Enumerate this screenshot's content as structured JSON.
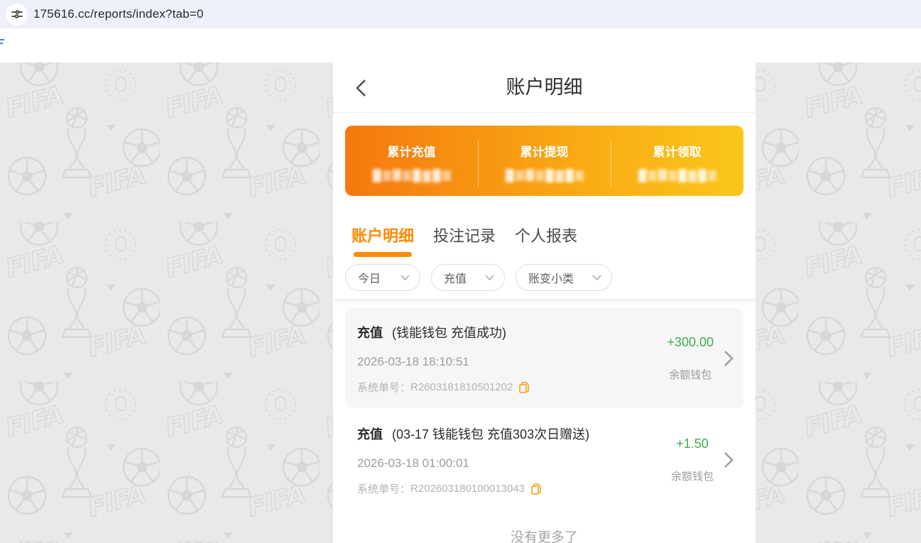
{
  "browser": {
    "url": "175616.cc/reports/index?tab=0",
    "site_info_icon": "tune-icon"
  },
  "header": {
    "title": "账户明细",
    "back_icon": "chevron-left"
  },
  "summary": {
    "cards": [
      {
        "label": "累计充值",
        "value_redacted": true
      },
      {
        "label": "累计提现",
        "value_redacted": true
      },
      {
        "label": "累计领取",
        "value_redacted": true
      }
    ],
    "gradient_start": "#f5780f",
    "gradient_end": "#fbc71b"
  },
  "tabs": [
    {
      "label": "账户明细",
      "active": true
    },
    {
      "label": "投注记录",
      "active": false
    },
    {
      "label": "个人报表",
      "active": false
    }
  ],
  "filters": [
    {
      "label": "今日"
    },
    {
      "label": "充值"
    },
    {
      "label": "账变小类"
    }
  ],
  "records": [
    {
      "type": "充值",
      "desc": "(钱能钱包 充值成功)",
      "datetime": "2026-03-18 18:10:51",
      "order_label": "系统单号：",
      "order_no": "R2603181810501202",
      "amount": "+300.00",
      "wallet": "余额钱包"
    },
    {
      "type": "充值",
      "desc": "(03-17 钱能钱包 充值303次日赠送)",
      "datetime": "2026-03-18 01:00:01",
      "order_label": "系统单号：",
      "order_no": "R202603180100013043",
      "amount": "+1.50",
      "wallet": "余额钱包"
    }
  ],
  "footer": {
    "no_more_label": "没有更多了"
  },
  "colors": {
    "accent_orange": "#ff8a00",
    "amount_green": "#3fae4a",
    "copy_orange": "#f7a827",
    "watermark_gray": "#d7d7d7"
  }
}
